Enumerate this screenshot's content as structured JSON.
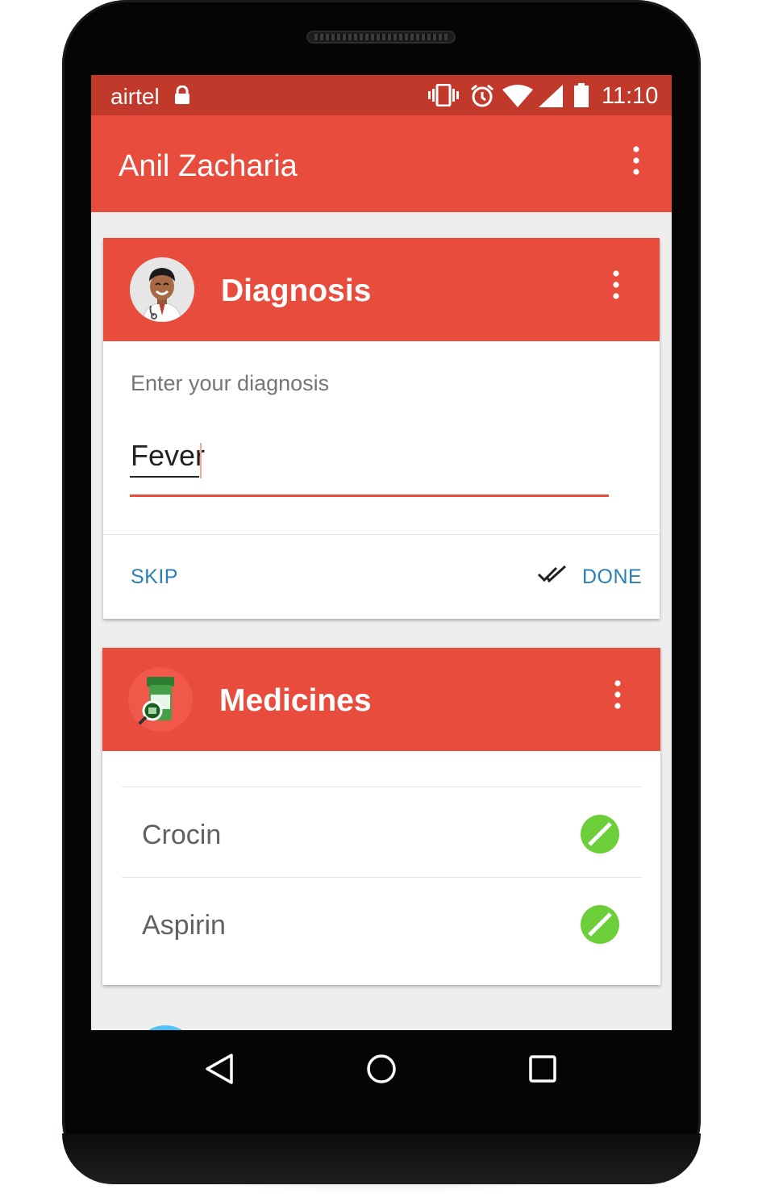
{
  "status_bar": {
    "carrier": "airtel",
    "time": "11:10",
    "icons": [
      "lock-icon",
      "vibrate-icon",
      "alarm-icon",
      "wifi-icon",
      "signal-icon",
      "battery-icon"
    ]
  },
  "app_bar": {
    "title": "Anil Zacharia",
    "menu_icon": "more-vert-icon"
  },
  "diagnosis_card": {
    "title": "Diagnosis",
    "avatar": "doctor-avatar",
    "field_label": "Enter your diagnosis",
    "field_value": "Fever",
    "skip_label": "SKIP",
    "done_label": "DONE",
    "done_icon": "done-all-icon"
  },
  "medicines_card": {
    "title": "Medicines",
    "avatar": "medicine-bottle-avatar",
    "items": [
      {
        "name": "Crocin",
        "icon": "pill-icon"
      },
      {
        "name": "Aspirin",
        "icon": "pill-icon"
      }
    ]
  },
  "nav_bar": {
    "icons": [
      "back-icon",
      "home-icon",
      "recents-icon"
    ]
  },
  "colors": {
    "primary": "#e74c3c",
    "primary_dark": "#c0392b",
    "accent_text": "#2980b9",
    "pill_green": "#6ccf3a"
  }
}
